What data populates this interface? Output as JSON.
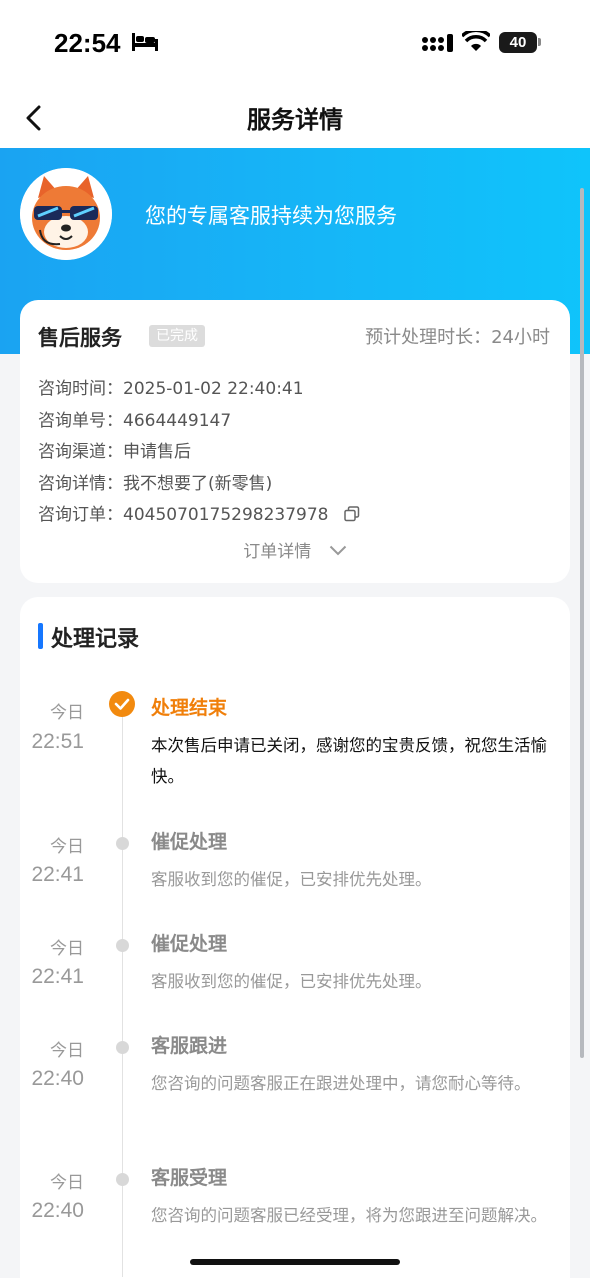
{
  "status_bar": {
    "time": "22:54",
    "battery": "40"
  },
  "nav": {
    "title": "服务详情"
  },
  "hero": {
    "text": "您的专属客服持续为您服务"
  },
  "service": {
    "title": "售后服务",
    "status": "已完成",
    "eta_label": "预计处理时长：24小时",
    "rows": [
      {
        "key": "咨询时间：",
        "value": "2025-01-02 22:40:41"
      },
      {
        "key": "咨询单号：",
        "value": "4664449147"
      },
      {
        "key": "咨询渠道：",
        "value": "申请售后"
      },
      {
        "key": "咨询详情：",
        "value": "我不想要了(新零售)"
      },
      {
        "key": "咨询订单：",
        "value": "4045070175298237978"
      }
    ],
    "order_detail_link": "订单详情"
  },
  "records": {
    "title": "处理记录",
    "items": [
      {
        "day": "今日",
        "time": "22:51",
        "title": "处理结束",
        "desc": "本次售后申请已关闭，感谢您的宝贵反馈，祝您生活愉快。"
      },
      {
        "day": "今日",
        "time": "22:41",
        "title": "催促处理",
        "desc": "客服收到您的催促，已安排优先处理。"
      },
      {
        "day": "今日",
        "time": "22:41",
        "title": "催促处理",
        "desc": "客服收到您的催促，已安排优先处理。"
      },
      {
        "day": "今日",
        "time": "22:40",
        "title": "客服跟进",
        "desc": "您咨询的问题客服正在跟进处理中，请您耐心等待。"
      },
      {
        "day": "今日",
        "time": "22:40",
        "title": "客服受理",
        "desc": "您咨询的问题客服已经受理，将为您跟进至问题解决。"
      }
    ]
  },
  "colors": {
    "accent_blue": "#1aa3f2",
    "done_orange": "#f07f0a"
  },
  "icons": [
    "bed-icon",
    "signal-icon",
    "wifi-icon",
    "back-arrow-icon",
    "copy-icon",
    "chevron-down-icon",
    "check-icon"
  ]
}
